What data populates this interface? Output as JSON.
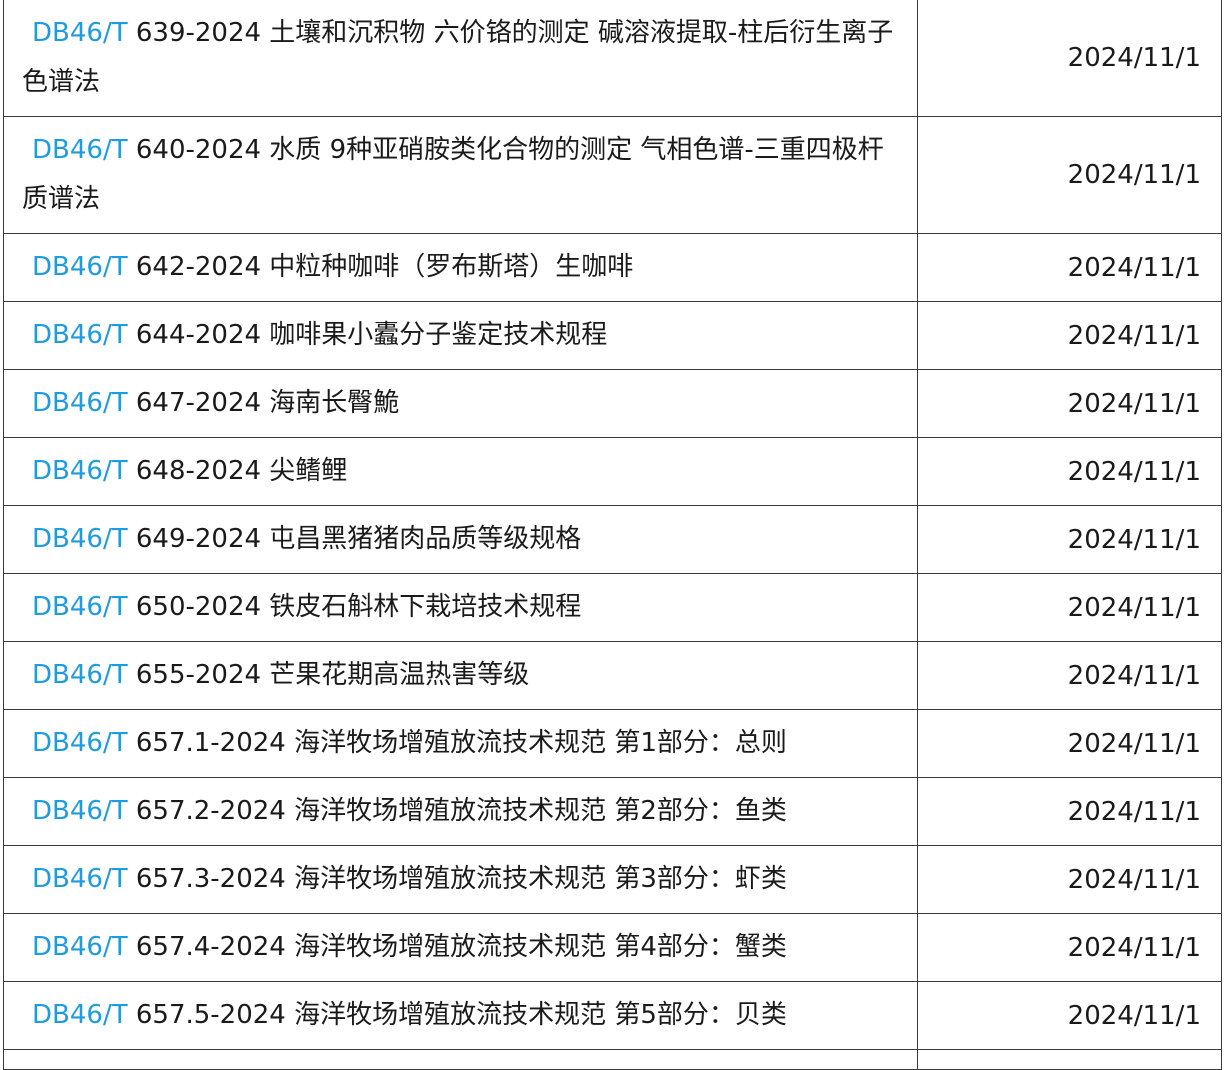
{
  "table": {
    "rows": [
      {
        "code": "DB46/T",
        "rest": " 639-2024 土壤和沉积物 六价铬的测定 碱溶液提取-柱后衍生离子色谱法",
        "date": "2024/11/1"
      },
      {
        "code": "DB46/T",
        "rest": " 640-2024 水质 9种亚硝胺类化合物的测定 气相色谱-三重四极杆质谱法",
        "date": "2024/11/1"
      },
      {
        "code": "DB46/T",
        "rest": " 642-2024 中粒种咖啡（罗布斯塔）生咖啡",
        "date": "2024/11/1"
      },
      {
        "code": "DB46/T",
        "rest": " 644-2024 咖啡果小蠹分子鉴定技术规程",
        "date": "2024/11/1"
      },
      {
        "code": "DB46/T",
        "rest": " 647-2024 海南长臀鮠",
        "date": "2024/11/1"
      },
      {
        "code": "DB46/T",
        "rest": " 648-2024 尖鳍鲤",
        "date": "2024/11/1"
      },
      {
        "code": "DB46/T",
        "rest": " 649-2024 屯昌黑猪猪肉品质等级规格",
        "date": "2024/11/1"
      },
      {
        "code": "DB46/T",
        "rest": " 650-2024 铁皮石斛林下栽培技术规程",
        "date": "2024/11/1"
      },
      {
        "code": "DB46/T",
        "rest": " 655-2024 芒果花期高温热害等级",
        "date": "2024/11/1"
      },
      {
        "code": "DB46/T",
        "rest": " 657.1-2024 海洋牧场增殖放流技术规范 第1部分：总则",
        "date": "2024/11/1"
      },
      {
        "code": "DB46/T",
        "rest": " 657.2-2024 海洋牧场增殖放流技术规范 第2部分：鱼类",
        "date": "2024/11/1"
      },
      {
        "code": "DB46/T",
        "rest": " 657.3-2024 海洋牧场增殖放流技术规范 第3部分：虾类",
        "date": "2024/11/1"
      },
      {
        "code": "DB46/T",
        "rest": " 657.4-2024 海洋牧场增殖放流技术规范 第4部分：蟹类",
        "date": "2024/11/1"
      },
      {
        "code": "DB46/T",
        "rest": " 657.5-2024 海洋牧场增殖放流技术规范 第5部分：贝类",
        "date": "2024/11/1"
      }
    ]
  },
  "colors": {
    "link": "#1f9be0",
    "text": "#1a1a1a",
    "border": "#3a3a3a"
  }
}
